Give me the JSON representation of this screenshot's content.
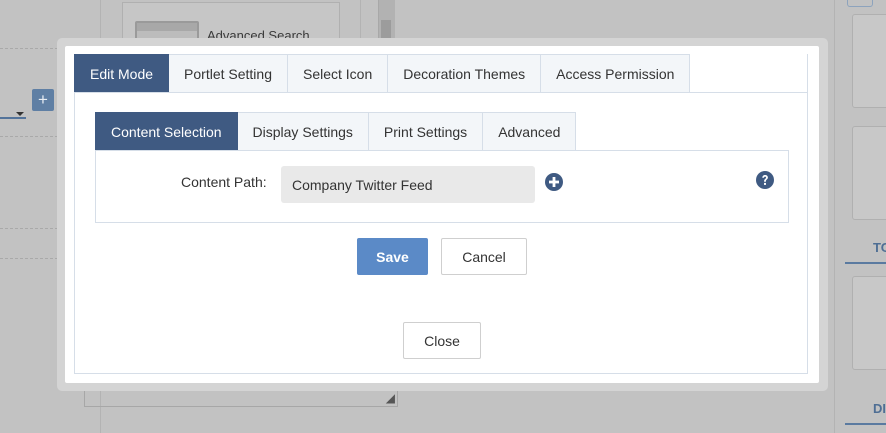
{
  "background": {
    "card_title": "Advanced Search",
    "right_tab_1": "TO",
    "right_tab_2": "DI",
    "plus_label": "+"
  },
  "modal": {
    "outer_tabs": [
      {
        "label": "Edit Mode",
        "active": true
      },
      {
        "label": "Portlet Setting",
        "active": false
      },
      {
        "label": "Select Icon",
        "active": false
      },
      {
        "label": "Decoration Themes",
        "active": false
      },
      {
        "label": "Access Permission",
        "active": false
      }
    ],
    "inner_tabs": [
      {
        "label": "Content Selection",
        "active": true
      },
      {
        "label": "Display Settings",
        "active": false
      },
      {
        "label": "Print Settings",
        "active": false
      },
      {
        "label": "Advanced",
        "active": false
      }
    ],
    "content_path": {
      "label": "Content Path:",
      "value": "Company Twitter Feed"
    },
    "save_label": "Save",
    "cancel_label": "Cancel",
    "close_label": "Close"
  },
  "icons": {
    "add": "plus-circle-icon",
    "help": "question-circle-icon"
  },
  "colors": {
    "active_tab": "#3f5a82",
    "save_button": "#5b8ac7",
    "icon": "#3f5a82"
  }
}
